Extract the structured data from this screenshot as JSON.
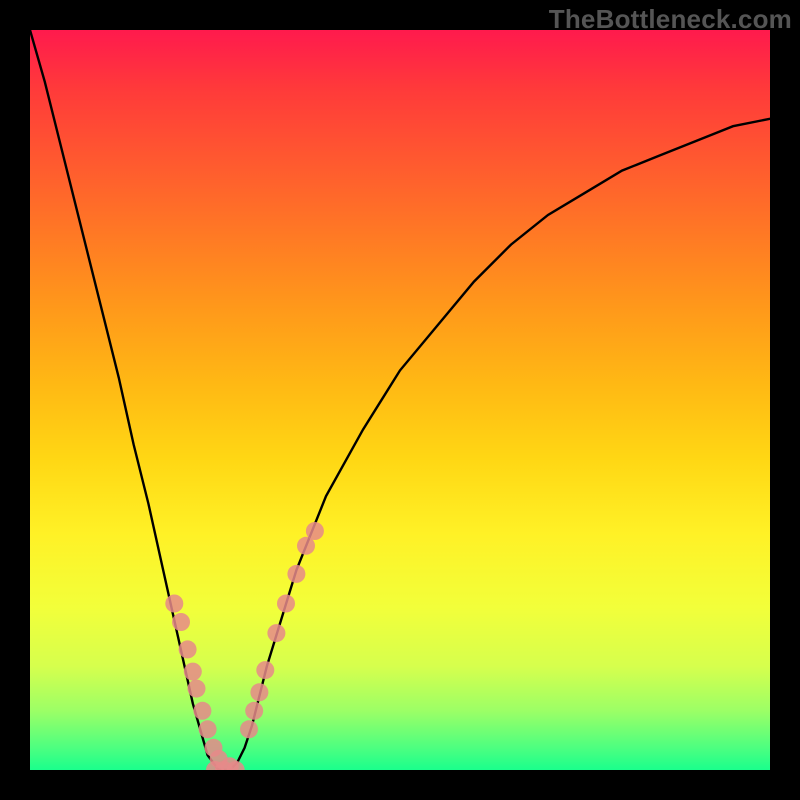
{
  "watermark": "TheBottleneck.com",
  "chart_data": {
    "type": "line",
    "title": "",
    "xlabel": "",
    "ylabel": "",
    "xlim": [
      0,
      1
    ],
    "ylim": [
      0,
      1
    ],
    "x": [
      0.0,
      0.02,
      0.04,
      0.06,
      0.08,
      0.1,
      0.12,
      0.14,
      0.16,
      0.18,
      0.2,
      0.22,
      0.24,
      0.255,
      0.27,
      0.28,
      0.29,
      0.3,
      0.32,
      0.36,
      0.4,
      0.45,
      0.5,
      0.55,
      0.6,
      0.65,
      0.7,
      0.75,
      0.8,
      0.85,
      0.9,
      0.95,
      1.0
    ],
    "values": [
      1.0,
      0.93,
      0.85,
      0.77,
      0.69,
      0.61,
      0.53,
      0.44,
      0.36,
      0.27,
      0.18,
      0.09,
      0.02,
      0.0,
      0.0,
      0.01,
      0.03,
      0.06,
      0.14,
      0.27,
      0.37,
      0.46,
      0.54,
      0.6,
      0.66,
      0.71,
      0.75,
      0.78,
      0.81,
      0.83,
      0.85,
      0.87,
      0.88
    ],
    "series": [
      {
        "name": "left-branch-dots",
        "x": [
          0.195,
          0.204,
          0.213,
          0.22,
          0.225,
          0.233,
          0.24,
          0.248,
          0.255,
          0.27
        ],
        "values": [
          0.225,
          0.2,
          0.163,
          0.133,
          0.11,
          0.08,
          0.055,
          0.03,
          0.015,
          0.005
        ]
      },
      {
        "name": "bottom-dots",
        "x": [
          0.25,
          0.262,
          0.278
        ],
        "values": [
          0.0,
          0.0,
          0.0
        ]
      },
      {
        "name": "right-branch-dots",
        "x": [
          0.296,
          0.303,
          0.31,
          0.318,
          0.333,
          0.346,
          0.36,
          0.373,
          0.385
        ],
        "values": [
          0.055,
          0.08,
          0.105,
          0.135,
          0.185,
          0.225,
          0.265,
          0.303,
          0.323
        ]
      }
    ],
    "background_gradient": {
      "top": "#ff1a4d",
      "bottom": "#1aff8c"
    }
  }
}
